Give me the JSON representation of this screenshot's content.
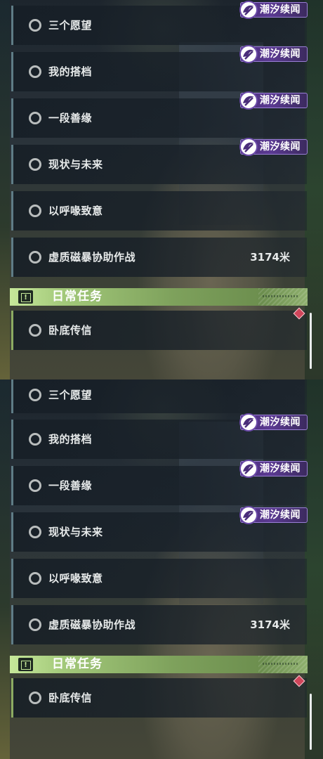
{
  "panels": [
    {
      "quests": [
        {
          "title": "三个愿望",
          "tag": "潮汐续闻"
        },
        {
          "title": "我的搭档",
          "tag": "潮汐续闻"
        },
        {
          "title": "一段善缘",
          "tag": "潮汐续闻"
        },
        {
          "title": "现状与未来",
          "tag": "潮汐续闻"
        },
        {
          "title": "以呼喙致意",
          "tag": ""
        },
        {
          "title": "虚质磁暴协助作战",
          "tag": "",
          "distance": "3174米"
        }
      ],
      "section": {
        "title": "日常任务"
      },
      "daily_quests": [
        {
          "title": "卧底传信"
        }
      ]
    },
    {
      "quests": [
        {
          "title": "三个愿望",
          "tag": ""
        },
        {
          "title": "我的搭档",
          "tag": "潮汐续闻"
        },
        {
          "title": "一段善缘",
          "tag": "潮汐续闻"
        },
        {
          "title": "现状与未来",
          "tag": "潮汐续闻"
        },
        {
          "title": "以呼喙致意",
          "tag": ""
        },
        {
          "title": "虚质磁暴协助作战",
          "tag": "",
          "distance": "3174米"
        }
      ],
      "section": {
        "title": "日常任务"
      },
      "daily_quests": [
        {
          "title": "卧底传信"
        }
      ]
    }
  ],
  "colors": {
    "tag_bg": "#5b3a92",
    "section_bg": "#a3c97a",
    "row_accent": "#5f7c86",
    "daily_accent": "#8cab62",
    "marker": "#d0455a"
  },
  "icons": {
    "quest_status": "circle-outline-icon",
    "tag": "tidal-wave-emblem-icon",
    "section": "exclamation-box-icon",
    "marker": "red-diamond-icon"
  }
}
